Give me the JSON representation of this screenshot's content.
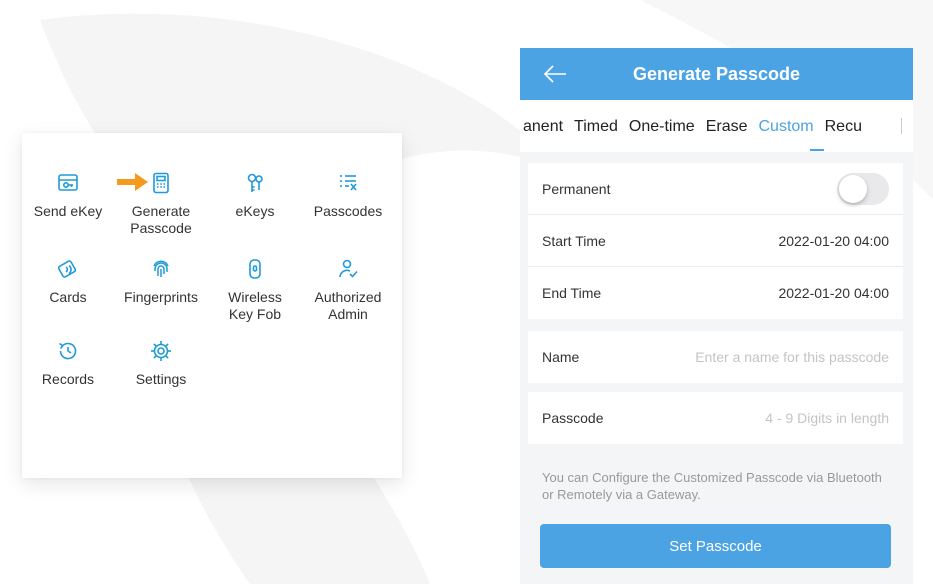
{
  "menu": {
    "items": [
      {
        "label": "Send eKey",
        "icon": "send-ekey-icon"
      },
      {
        "label": "Generate\nPasscode",
        "icon": "generate-passcode-icon"
      },
      {
        "label": "eKeys",
        "icon": "ekeys-icon"
      },
      {
        "label": "Passcodes",
        "icon": "passcodes-icon"
      },
      {
        "label": "Cards",
        "icon": "cards-icon"
      },
      {
        "label": "Fingerprints",
        "icon": "fingerprint-icon"
      },
      {
        "label": "Wireless\nKey Fob",
        "icon": "key-fob-icon"
      },
      {
        "label": "Authorized\nAdmin",
        "icon": "authorized-admin-icon"
      },
      {
        "label": "Records",
        "icon": "records-icon"
      },
      {
        "label": "Settings",
        "icon": "settings-icon"
      }
    ],
    "pointer": "arrow-right-icon"
  },
  "header": {
    "title": "Generate Passcode",
    "back_icon": "back-arrow-icon"
  },
  "tabs": [
    {
      "label": "anent"
    },
    {
      "label": "Timed"
    },
    {
      "label": "One-time"
    },
    {
      "label": "Erase"
    },
    {
      "label": "Custom",
      "active": true
    },
    {
      "label": "Recu"
    }
  ],
  "form": {
    "permanent": {
      "label": "Permanent",
      "enabled": false
    },
    "start_time": {
      "label": "Start Time",
      "value": "2022-01-20 04:00"
    },
    "end_time": {
      "label": "End Time",
      "value": "2022-01-20 04:00"
    },
    "name": {
      "label": "Name",
      "placeholder": "Enter a name for this passcode"
    },
    "passcode": {
      "label": "Passcode",
      "placeholder": "4 - 9 Digits in length"
    }
  },
  "hint": "You can Configure the Customized Passcode via Bluetooth or Remotely via a Gateway.",
  "submit_label": "Set Passcode",
  "colors": {
    "primary": "#4ba3e3",
    "icon": "#1f9bd7",
    "pointer": "#f39a1f",
    "background": "#f4f5f7"
  }
}
